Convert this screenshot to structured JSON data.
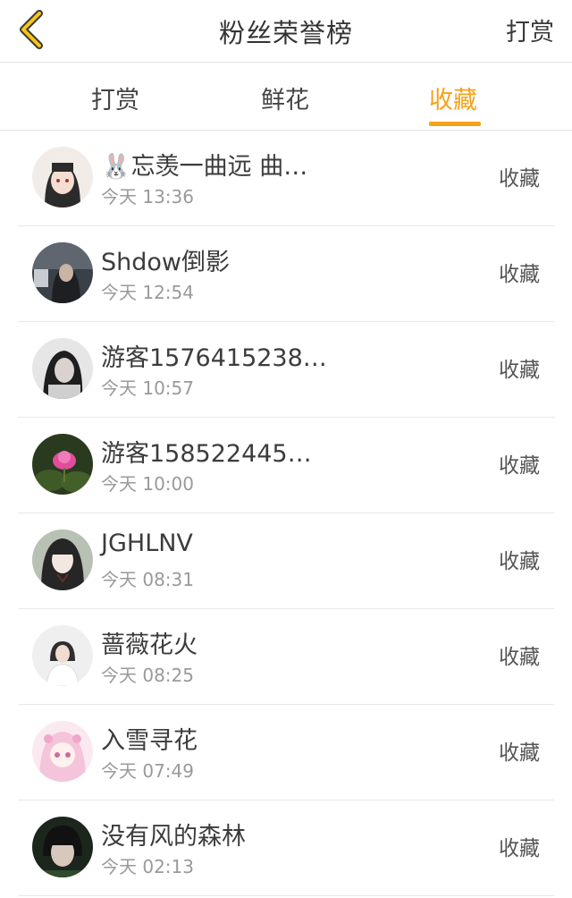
{
  "header": {
    "title": "粉丝荣誉榜",
    "right_link": "打赏",
    "back_icon": "chevron-left-icon",
    "accent_color": "#f5a21b"
  },
  "tabs": [
    {
      "label": "打赏",
      "active": false
    },
    {
      "label": "鲜花",
      "active": false
    },
    {
      "label": "收藏",
      "active": true
    }
  ],
  "fans": [
    {
      "name": "🐰忘羡一曲远 曲…",
      "time": "今天 13:36",
      "action": "收藏"
    },
    {
      "name": "Shdow倒影",
      "time": "今天 12:54",
      "action": "收藏"
    },
    {
      "name": "游客1576415238…",
      "time": "今天 10:57",
      "action": "收藏"
    },
    {
      "name": "游客158522445…",
      "time": "今天 10:00",
      "action": "收藏"
    },
    {
      "name": "JGHLNV",
      "time": "今天 08:31",
      "action": "收藏"
    },
    {
      "name": "蔷薇花火",
      "time": "今天 08:25",
      "action": "收藏"
    },
    {
      "name": "入雪寻花",
      "time": "今天 07:49",
      "action": "收藏"
    },
    {
      "name": "没有风的森林",
      "time": "今天 02:13",
      "action": "收藏"
    }
  ]
}
